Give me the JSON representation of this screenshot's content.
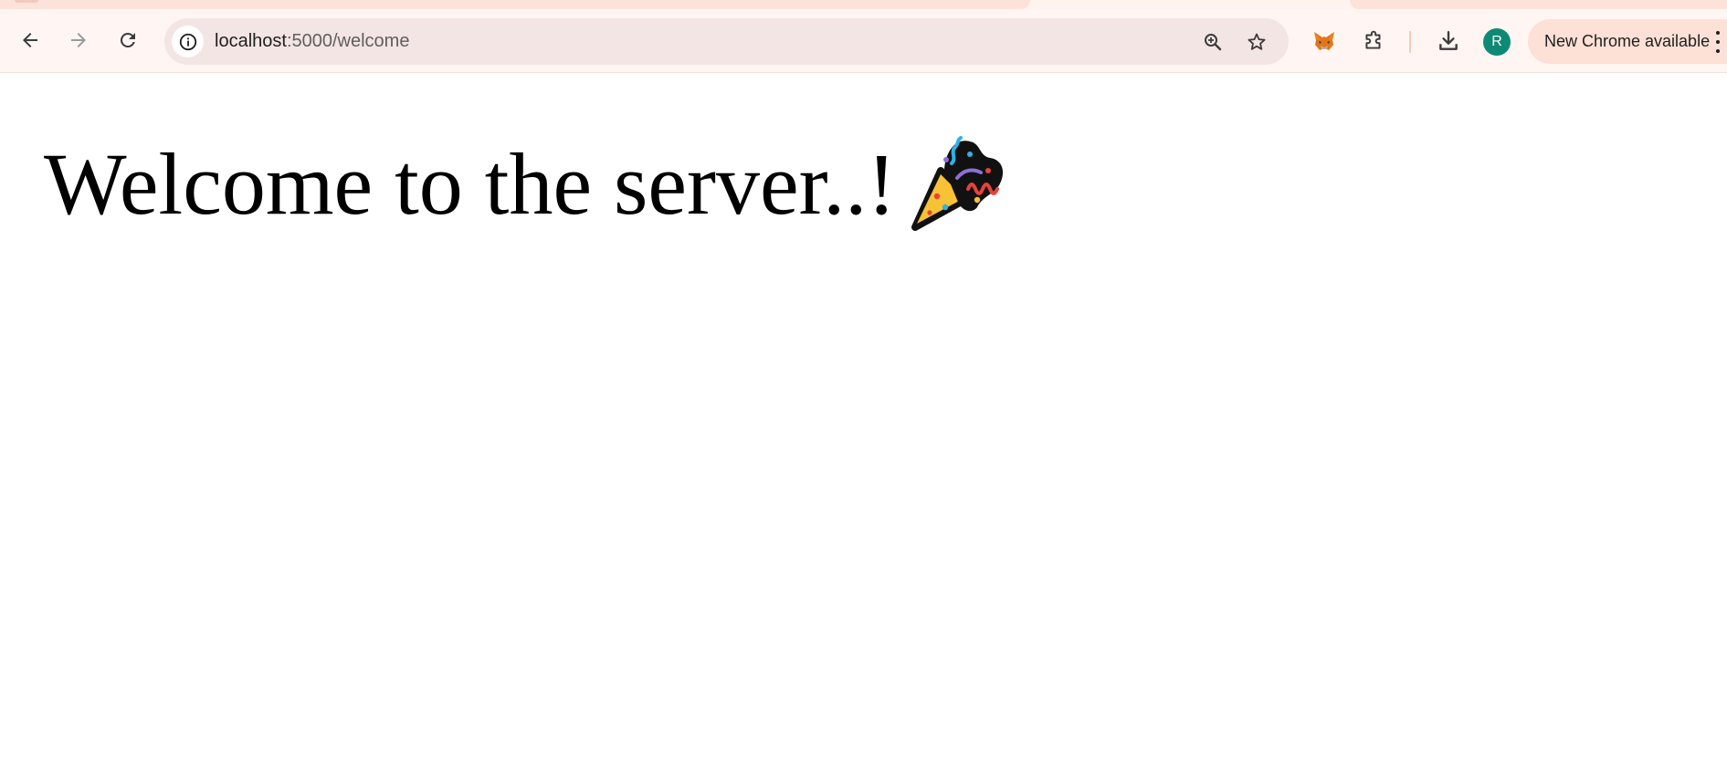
{
  "browser": {
    "url_host": "localhost",
    "url_path": ":5000/welcome",
    "profile_initial": "R",
    "update_label": "New Chrome available",
    "icons": {
      "back": "arrow-left-icon",
      "forward": "arrow-right-icon",
      "reload": "reload-icon",
      "site_info": "info-icon",
      "zoom": "zoom-in-icon",
      "bookmark": "star-icon",
      "metamask": "fox-icon",
      "extensions": "puzzle-icon",
      "downloads": "download-icon",
      "menu": "more-vert-icon"
    },
    "colors": {
      "toolbar_bg": "#fff6f3",
      "omnibox_bg": "#f3e5e3",
      "avatar_bg": "#0e8a74",
      "update_chip_bg": "#fde0d6"
    }
  },
  "page": {
    "heading": "Welcome to the server..!",
    "heading_emoji": "party-popper-icon"
  }
}
